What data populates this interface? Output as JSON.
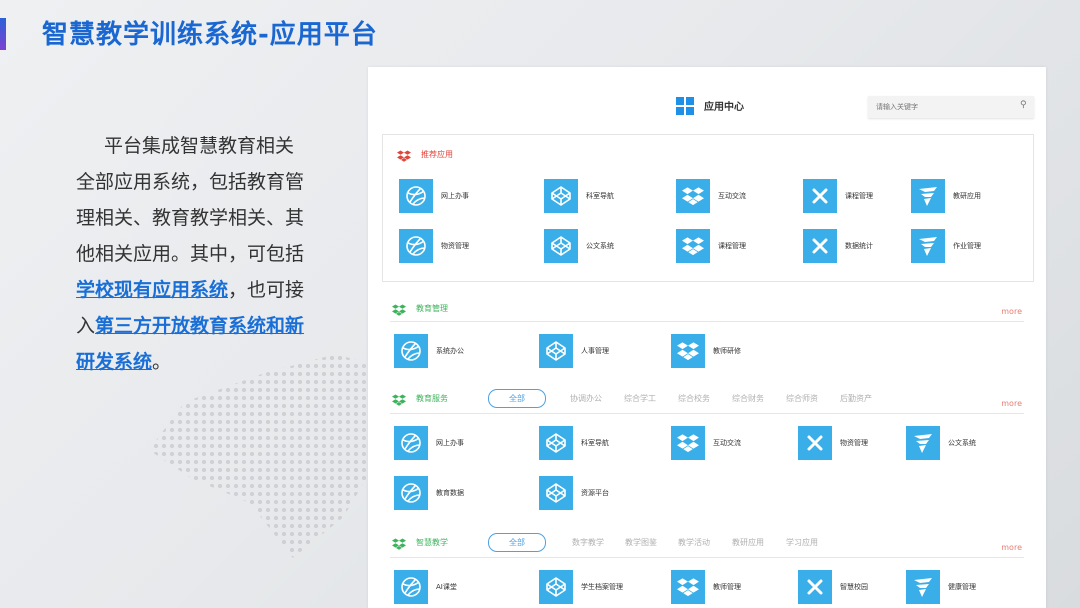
{
  "slide": {
    "title": "智慧教学训练系统-应用平台",
    "description_start": "平台集成智慧教育相关全部应用系统，包括教育管理相关、教育教学相关、其他相关应用。其中，可包括",
    "highlight_1": "学校现有应用系统",
    "description_mid": "，也可接入",
    "highlight_2": "第三方开放教育系统和新研发系统",
    "description_end": "。"
  },
  "app_center": {
    "title": "应用中心",
    "search_placeholder": "请输入关键字",
    "more_label": "more",
    "recommended": {
      "label": "推荐应用",
      "apps": [
        {
          "name": "网上办事",
          "icon": "basketball-icon"
        },
        {
          "name": "科室导航",
          "icon": "codepen-icon"
        },
        {
          "name": "互动交流",
          "icon": "dropbox-icon"
        },
        {
          "name": "课程管理",
          "icon": "x-icon"
        },
        {
          "name": "教研应用",
          "icon": "wing-icon"
        },
        {
          "name": "物资管理",
          "icon": "basketball-icon"
        },
        {
          "name": "公文系统",
          "icon": "codepen-icon"
        },
        {
          "name": "课程管理",
          "icon": "dropbox-icon"
        },
        {
          "name": "数据统计",
          "icon": "x-icon"
        },
        {
          "name": "作业管理",
          "icon": "wing-icon"
        }
      ]
    },
    "edu_management": {
      "label": "教育管理",
      "apps": [
        {
          "name": "系统办公",
          "icon": "basketball-icon"
        },
        {
          "name": "人事管理",
          "icon": "codepen-icon"
        },
        {
          "name": "教师研修",
          "icon": "dropbox-icon"
        }
      ]
    },
    "edu_service": {
      "label": "教育服务",
      "tabs": [
        "全部",
        "协调办公",
        "综合学工",
        "综合校务",
        "综合财务",
        "综合师资",
        "后勤资产"
      ],
      "apps": [
        {
          "name": "网上办事",
          "icon": "basketball-icon"
        },
        {
          "name": "科室导航",
          "icon": "codepen-icon"
        },
        {
          "name": "互动交流",
          "icon": "dropbox-icon"
        },
        {
          "name": "物资管理",
          "icon": "x-icon"
        },
        {
          "name": "公文系统",
          "icon": "wing-icon"
        },
        {
          "name": "教育数据",
          "icon": "basketball-icon"
        },
        {
          "name": "资源平台",
          "icon": "codepen-icon"
        }
      ]
    },
    "smart_teaching": {
      "label": "智慧教学",
      "tabs": [
        "全部",
        "数字教学",
        "教学图鉴",
        "教学活动",
        "教研应用",
        "学习应用"
      ],
      "apps": [
        {
          "name": "AI课堂",
          "icon": "basketball-icon"
        },
        {
          "name": "学生档案管理",
          "icon": "codepen-icon"
        },
        {
          "name": "教师管理",
          "icon": "dropbox-icon"
        },
        {
          "name": "智慧校园",
          "icon": "x-icon"
        },
        {
          "name": "健康管理",
          "icon": "wing-icon"
        }
      ]
    }
  },
  "colors": {
    "title_blue": "#1a67d2",
    "icon_blue": "#3aaee9",
    "recommend_red": "#e0453a",
    "section_green": "#3db35c",
    "more_red": "#e67e73"
  }
}
